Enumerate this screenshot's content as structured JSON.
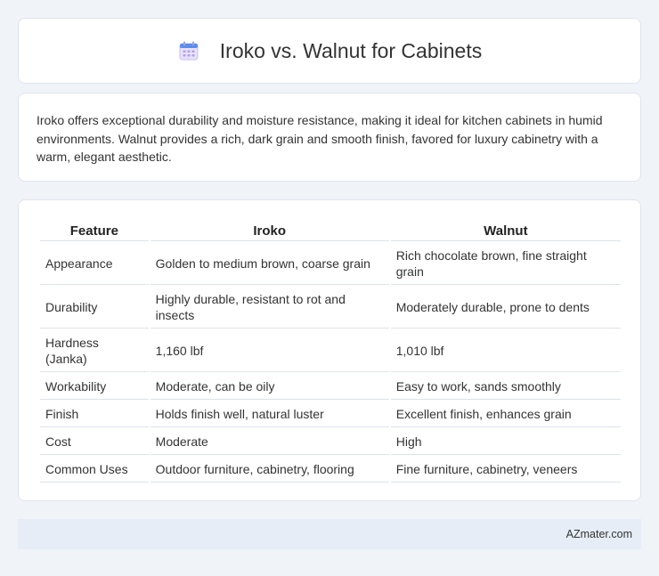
{
  "header": {
    "icon": "calendar-icon",
    "title": "Iroko vs. Walnut for Cabinets"
  },
  "intro": {
    "text": "Iroko offers exceptional durability and moisture resistance, making it ideal for kitchen cabinets in humid environments. Walnut provides a rich, dark grain and smooth finish, favored for luxury cabinetry with a warm, elegant aesthetic."
  },
  "table": {
    "headers": [
      "Feature",
      "Iroko",
      "Walnut"
    ],
    "rows": [
      [
        "Appearance",
        "Golden to medium brown, coarse grain",
        "Rich chocolate brown, fine straight grain"
      ],
      [
        "Durability",
        "Highly durable, resistant to rot and insects",
        "Moderately durable, prone to dents"
      ],
      [
        "Hardness (Janka)",
        "1,160 lbf",
        "1,010 lbf"
      ],
      [
        "Workability",
        "Moderate, can be oily",
        "Easy to work, sands smoothly"
      ],
      [
        "Finish",
        "Holds finish well, natural luster",
        "Excellent finish, enhances grain"
      ],
      [
        "Cost",
        "Moderate",
        "High"
      ],
      [
        "Common Uses",
        "Outdoor furniture, cabinetry, flooring",
        "Fine furniture, cabinetry, veneers"
      ]
    ]
  },
  "footer": {
    "text": "AZmater.com"
  }
}
